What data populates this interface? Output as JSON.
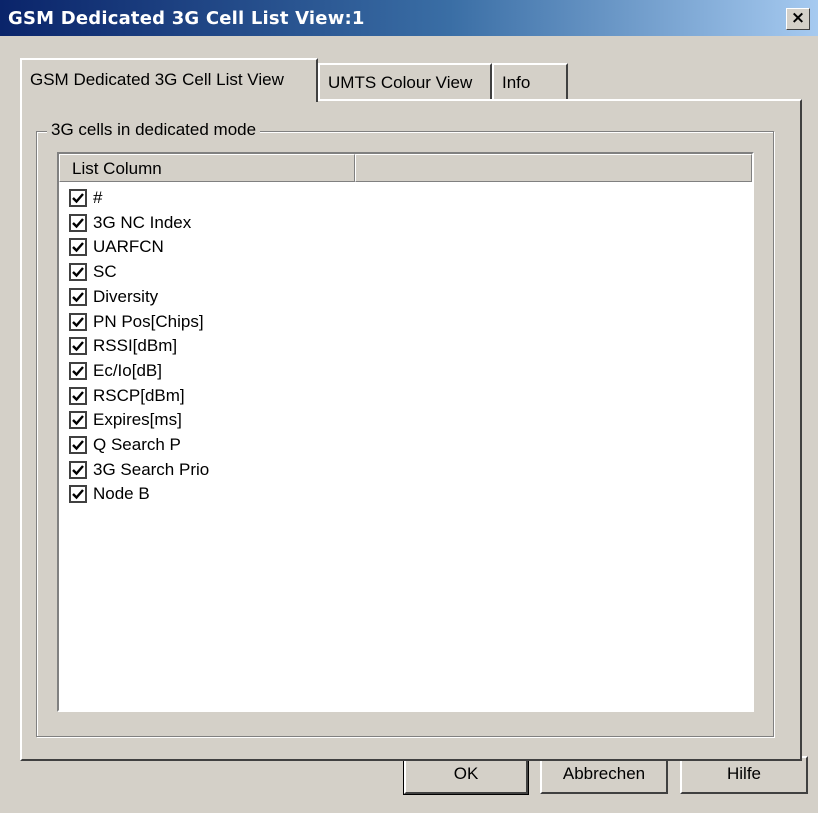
{
  "window": {
    "title": "GSM Dedicated 3G Cell List View:1",
    "close_label": "×"
  },
  "tabs": [
    {
      "label": "GSM Dedicated 3G Cell List View",
      "selected": true
    },
    {
      "label": "UMTS Colour View",
      "selected": false
    },
    {
      "label": "Info",
      "selected": false
    }
  ],
  "group": {
    "label": "3G cells in dedicated mode"
  },
  "list": {
    "columns": [
      "List Column",
      ""
    ],
    "items": [
      {
        "label": "#",
        "checked": true
      },
      {
        "label": "3G NC Index",
        "checked": true
      },
      {
        "label": "UARFCN",
        "checked": true
      },
      {
        "label": "SC",
        "checked": true
      },
      {
        "label": "Diversity",
        "checked": true
      },
      {
        "label": "PN Pos[Chips]",
        "checked": true
      },
      {
        "label": "RSSI[dBm]",
        "checked": true
      },
      {
        "label": "Ec/Io[dB]",
        "checked": true
      },
      {
        "label": "RSCP[dBm]",
        "checked": true
      },
      {
        "label": "Expires[ms]",
        "checked": true
      },
      {
        "label": "Q Search P",
        "checked": true
      },
      {
        "label": "3G Search Prio",
        "checked": true
      },
      {
        "label": "Node B",
        "checked": true
      }
    ]
  },
  "buttons": {
    "ok": "OK",
    "cancel": "Abbrechen",
    "help": "Hilfe"
  }
}
